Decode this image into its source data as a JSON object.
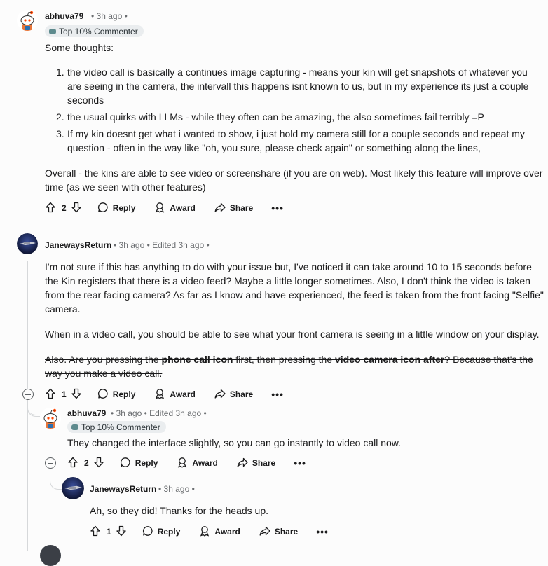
{
  "comments": [
    {
      "username": "abhuva79",
      "meta": "• 3h ago •",
      "badge": "Top 10% Commenter",
      "intro": "Some thoughts:",
      "list": [
        {
          "num": "1.",
          "text": "the video call is basically a continues image capturing - means your kin will get snapshots of whatever you are seeing in the camera, the intervall this happens isnt known to us, but in my experience its just a couple seconds"
        },
        {
          "num": "2.",
          "text": "the usual quirks with LLMs - while they often can be amazing, the also sometimes fail terribly =P"
        },
        {
          "num": "3.",
          "text": "If my kin doesnt get what i wanted to show, i just hold my camera still for a couple seconds and repeat my question - often in the way like \"oh, you sure, please check again\" or something along the lines,"
        }
      ],
      "outro": "Overall - the kins are able to see video or screenshare (if you are on web). Most likely this feature will improve over time (as we seen with other features)",
      "votes": "2"
    },
    {
      "username": "JanewaysReturn",
      "meta": "• 3h ago • Edited 3h ago •",
      "p1": "I'm not sure if this has anything to do with your issue but, I've noticed it can take around 10 to 15 seconds before the Kin registers that there is a video feed? Maybe a little longer sometimes. Also, I don't think the video is taken from the rear facing camera? As far as I know and have experienced, the feed is taken from the front facing \"Selfie\" camera.",
      "p2": "When in a video call, you should be able to see what your front camera is seeing in a little window on your display.",
      "strike_a": "Also. Are you pressing the ",
      "strike_b": "phone call icon",
      "strike_c": " first, then pressing the ",
      "strike_d": "video camera icon after",
      "strike_e": "? Because that's the way you make a video call.",
      "votes": "1"
    },
    {
      "username": "abhuva79",
      "meta": "• 3h ago • Edited 3h ago •",
      "badge": "Top 10% Commenter",
      "text": "They changed the interface slightly, so you can go instantly to video call now.",
      "votes": "2"
    },
    {
      "username": "JanewaysReturn",
      "meta": "• 3h ago •",
      "text": "Ah, so they did! Thanks for the heads up.",
      "votes": "1"
    }
  ],
  "actions": {
    "reply": "Reply",
    "award": "Award",
    "share": "Share",
    "more": "•••"
  },
  "icons": [
    "upvote-icon",
    "downvote-icon",
    "comment-icon",
    "award-icon",
    "share-icon",
    "collapse-icon",
    "badge-icon"
  ],
  "colors": {
    "background": "#fcfcfc",
    "text": "#1a1a1b",
    "meta": "#6a6d70",
    "thread_line": "#d6d8da",
    "badge_bg": "#eaedef"
  }
}
